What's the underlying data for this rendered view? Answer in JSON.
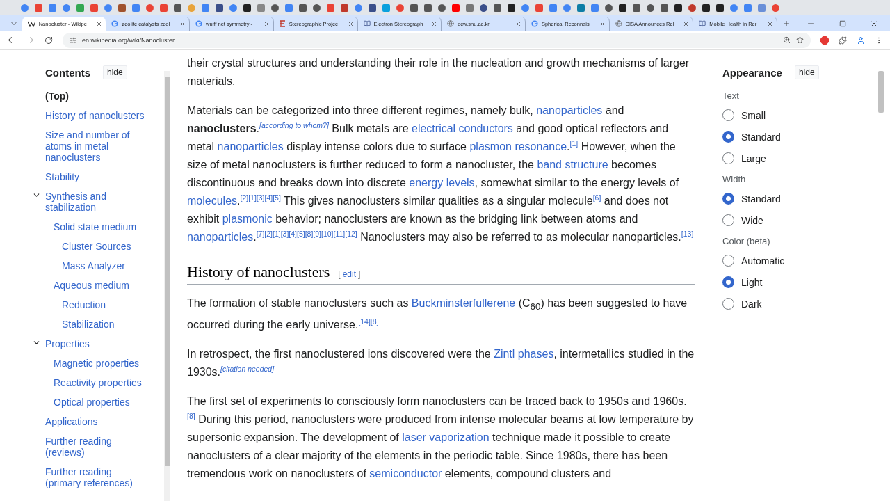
{
  "tabs": [
    {
      "title": "Nanocluster - Wikipe",
      "selected": true
    },
    {
      "title": "zeolite catalysts zeol",
      "selected": false
    },
    {
      "title": "wulff net symmetry -",
      "selected": false
    },
    {
      "title": "Stereographic Projec",
      "selected": false
    },
    {
      "title": "Electron Stereograph",
      "selected": false
    },
    {
      "title": "ocw.snu.ac.kr",
      "selected": false
    },
    {
      "title": "Spherical Reconnais",
      "selected": false
    },
    {
      "title": "CISA Announces Rel",
      "selected": false
    },
    {
      "title": "Mobile Health in Rer",
      "selected": false
    }
  ],
  "address": "en.wikipedia.org/wiki/Nanocluster",
  "contents": {
    "title": "Contents",
    "hide": "hide",
    "items": [
      {
        "label": "(Top)",
        "selected": true
      },
      {
        "label": "History of nanoclusters",
        "selected": false
      },
      {
        "label": "Size and number of atoms in metal nanoclusters",
        "selected": false
      },
      {
        "label": "Stability",
        "selected": false
      },
      {
        "label": "Synthesis and stabilization",
        "selected": false,
        "expanded": true,
        "children": [
          {
            "label": "Solid state medium",
            "selected": false,
            "children": [
              {
                "label": "Cluster Sources",
                "selected": false
              },
              {
                "label": "Mass Analyzer",
                "selected": false
              }
            ]
          },
          {
            "label": "Aqueous medium",
            "selected": false,
            "children": [
              {
                "label": "Reduction",
                "selected": false
              },
              {
                "label": "Stabilization",
                "selected": false
              }
            ]
          }
        ]
      },
      {
        "label": "Properties",
        "selected": false,
        "expanded": true,
        "children": [
          {
            "label": "Magnetic properties",
            "selected": false
          },
          {
            "label": "Reactivity properties",
            "selected": false
          },
          {
            "label": "Optical properties",
            "selected": false
          }
        ]
      },
      {
        "label": "Applications",
        "selected": false
      },
      {
        "label": "Further reading (reviews)",
        "selected": false
      },
      {
        "label": "Further reading (primary references)",
        "selected": false
      }
    ]
  },
  "article": {
    "blocks": [
      {
        "kind": "paragraph",
        "segments": [
          {
            "kind": "text",
            "text": "their crystal structures and understanding their role in the nucleation and growth mechanisms of larger materials."
          }
        ]
      },
      {
        "kind": "paragraph",
        "segments": [
          {
            "kind": "text",
            "text": "Materials can be categorized into three different regimes, namely bulk, "
          },
          {
            "kind": "link",
            "text": "nanoparticles"
          },
          {
            "kind": "text",
            "text": " and **nanoclusters**."
          },
          {
            "kind": "note",
            "text": "[according to whom?]"
          },
          {
            "kind": "text",
            "text": " Bulk metals are "
          },
          {
            "kind": "link",
            "text": "electrical conductors"
          },
          {
            "kind": "text",
            "text": " and good optical reflectors and metal "
          },
          {
            "kind": "link",
            "text": "nanoparticles"
          },
          {
            "kind": "text",
            "text": " display intense colors due to surface "
          },
          {
            "kind": "link",
            "text": "plasmon resonance"
          },
          {
            "kind": "text",
            "text": "."
          },
          {
            "kind": "ref",
            "text": "[1]"
          },
          {
            "kind": "text",
            "text": " However, when the size of metal nanoclusters is further reduced to form a nanocluster, the "
          },
          {
            "kind": "link",
            "text": "band structure"
          },
          {
            "kind": "text",
            "text": " becomes discontinuous and breaks down into discrete "
          },
          {
            "kind": "link",
            "text": "energy levels"
          },
          {
            "kind": "text",
            "text": ", somewhat similar to the energy levels of "
          },
          {
            "kind": "link",
            "text": "molecules"
          },
          {
            "kind": "text",
            "text": "."
          },
          {
            "kind": "ref",
            "text": "[2][1][3][4][5]"
          },
          {
            "kind": "text",
            "text": " This gives nanoclusters similar qualities as a singular molecule"
          },
          {
            "kind": "ref",
            "text": "[6]"
          },
          {
            "kind": "text",
            "text": " and does not exhibit "
          },
          {
            "kind": "link",
            "text": "plasmonic"
          },
          {
            "kind": "text",
            "text": " behavior; nanoclusters are known as the bridging link between atoms and "
          },
          {
            "kind": "link",
            "text": "nanoparticles"
          },
          {
            "kind": "text",
            "text": "."
          },
          {
            "kind": "ref",
            "text": "[7][2][1][3][4][5][8][9][10][11][12]"
          },
          {
            "kind": "text",
            "text": " Nanoclusters may also be referred to as molecular nanoparticles."
          },
          {
            "kind": "ref",
            "text": "[13]"
          }
        ]
      },
      {
        "kind": "heading",
        "text": "History of nanoclusters",
        "edit_open": "[",
        "edit": "edit",
        "edit_close": "]"
      },
      {
        "kind": "paragraph",
        "segments": [
          {
            "kind": "text",
            "text": "The formation of stable nanoclusters such as "
          },
          {
            "kind": "link",
            "text": "Buckminsterfullerene"
          },
          {
            "kind": "text",
            "text": " (C$_{60}$) has been suggested to have occurred during the early universe."
          },
          {
            "kind": "ref",
            "text": "[14][8]"
          }
        ]
      },
      {
        "kind": "paragraph",
        "segments": [
          {
            "kind": "text",
            "text": "In retrospect, the first nanoclustered ions discovered were the "
          },
          {
            "kind": "link",
            "text": "Zintl phases"
          },
          {
            "kind": "text",
            "text": ", intermetallics studied in the 1930s."
          },
          {
            "kind": "note",
            "text": "[citation needed]"
          }
        ]
      },
      {
        "kind": "paragraph",
        "segments": [
          {
            "kind": "text",
            "text": "The first set of experiments to consciously form nanoclusters can be traced back to 1950s and 1960s."
          },
          {
            "kind": "ref",
            "text": "[8]"
          },
          {
            "kind": "text",
            "text": " During this period, nanoclusters were produced from intense molecular beams at low temperature by supersonic expansion. The development of "
          },
          {
            "kind": "link",
            "text": "laser vaporization"
          },
          {
            "kind": "text",
            "text": " technique made it possible to create nanoclusters of a clear majority of the elements in the periodic table. Since 1980s, there has been tremendous work on nanoclusters of "
          },
          {
            "kind": "link",
            "text": "semiconductor"
          },
          {
            "kind": "text",
            "text": " elements, compound clusters and"
          }
        ]
      }
    ]
  },
  "appearance": {
    "title": "Appearance",
    "hide": "hide",
    "groups": [
      {
        "label": "Text",
        "options": [
          {
            "label": "Small",
            "selected": false
          },
          {
            "label": "Standard",
            "selected": true
          },
          {
            "label": "Large",
            "selected": false
          }
        ]
      },
      {
        "label": "Width",
        "options": [
          {
            "label": "Standard",
            "selected": true
          },
          {
            "label": "Wide",
            "selected": false
          }
        ]
      },
      {
        "label": "Color (beta)",
        "options": [
          {
            "label": "Automatic",
            "selected": false
          },
          {
            "label": "Light",
            "selected": true
          },
          {
            "label": "Dark",
            "selected": false
          }
        ]
      }
    ]
  }
}
